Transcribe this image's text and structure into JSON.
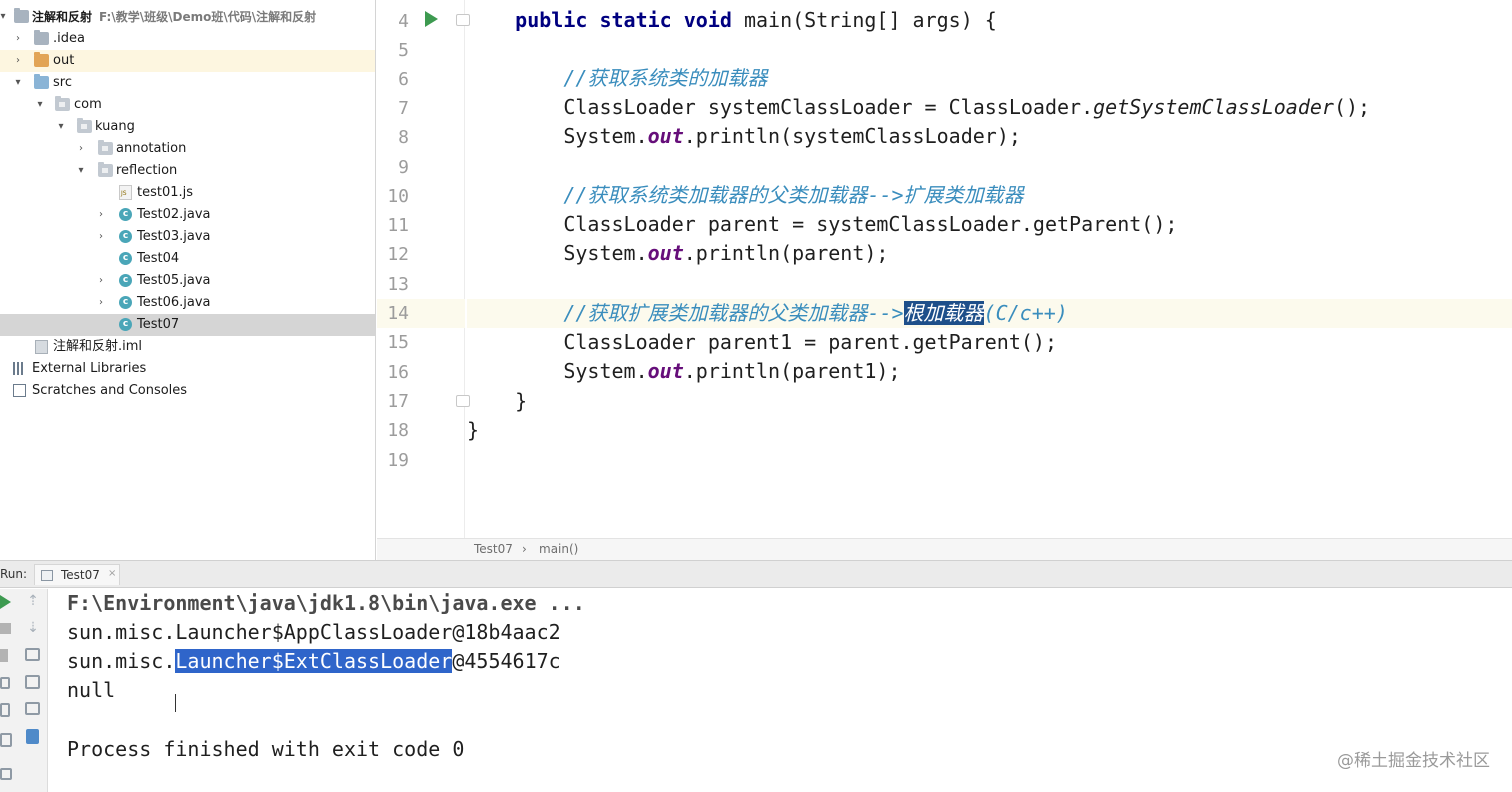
{
  "project_tree": {
    "root": {
      "label": "注解和反射",
      "path": "F:\\教学\\班级\\Demo班\\代码\\注解和反射"
    },
    "items": [
      {
        "label": ".idea"
      },
      {
        "label": "out"
      },
      {
        "label": "src"
      },
      {
        "label": "com"
      },
      {
        "label": "kuang"
      },
      {
        "label": "annotation"
      },
      {
        "label": "reflection"
      },
      {
        "label": "test01.js"
      },
      {
        "label": "Test02.java"
      },
      {
        "label": "Test03.java"
      },
      {
        "label": "Test04"
      },
      {
        "label": "Test05.java"
      },
      {
        "label": "Test06.java"
      },
      {
        "label": "Test07"
      },
      {
        "label": "注解和反射.iml"
      },
      {
        "label": "External Libraries"
      },
      {
        "label": "Scratches and Consoles"
      }
    ]
  },
  "editor": {
    "line_numbers": [
      "4",
      "5",
      "6",
      "7",
      "8",
      "9",
      "10",
      "11",
      "12",
      "13",
      "14",
      "15",
      "16",
      "17",
      "18",
      "19"
    ],
    "code": {
      "l4_kw": "public static void",
      "l4_rest": " main(String[] args) {",
      "l6_comment": "//获取系统类的加载器",
      "l7_a": "ClassLoader systemClassLoader = ClassLoader.",
      "l7_m": "getSystemClassLoader",
      "l7_b": "();",
      "l8_a": "System.",
      "l8_f": "out",
      "l8_b": ".println(systemClassLoader);",
      "l10_comment": "//获取系统类加载器的父类加载器-->扩展类加载器",
      "l11": "ClassLoader parent = systemClassLoader.getParent();",
      "l12_a": "System.",
      "l12_f": "out",
      "l12_b": ".println(parent);",
      "l14_comment_a": "//获取扩展类加载器的父类加载器-->",
      "l14_comment_sel": "根加载器",
      "l14_comment_b": "(C/c++)",
      "l15": "ClassLoader parent1 = parent.getParent();",
      "l16_a": "System.",
      "l16_f": "out",
      "l16_b": ".println(parent1);",
      "l17": "}",
      "l18": "}"
    },
    "breadcrumb": {
      "class": "Test07",
      "sep": "›",
      "method": "main()"
    }
  },
  "run": {
    "label": "Run:",
    "tab_label": "Test07",
    "tab_close": "×",
    "output": {
      "cmd": "F:\\Environment\\java\\jdk1.8\\bin\\java.exe ...",
      "line1": "sun.misc.Launcher$AppClassLoader@18b4aac2",
      "line2_a": "sun.misc.",
      "line2_sel": "Launcher$ExtClassLoader",
      "line2_b": "@4554617c",
      "line3": "null",
      "line4": "Process finished with exit code 0"
    }
  },
  "watermark": "@稀土掘金技术社区"
}
